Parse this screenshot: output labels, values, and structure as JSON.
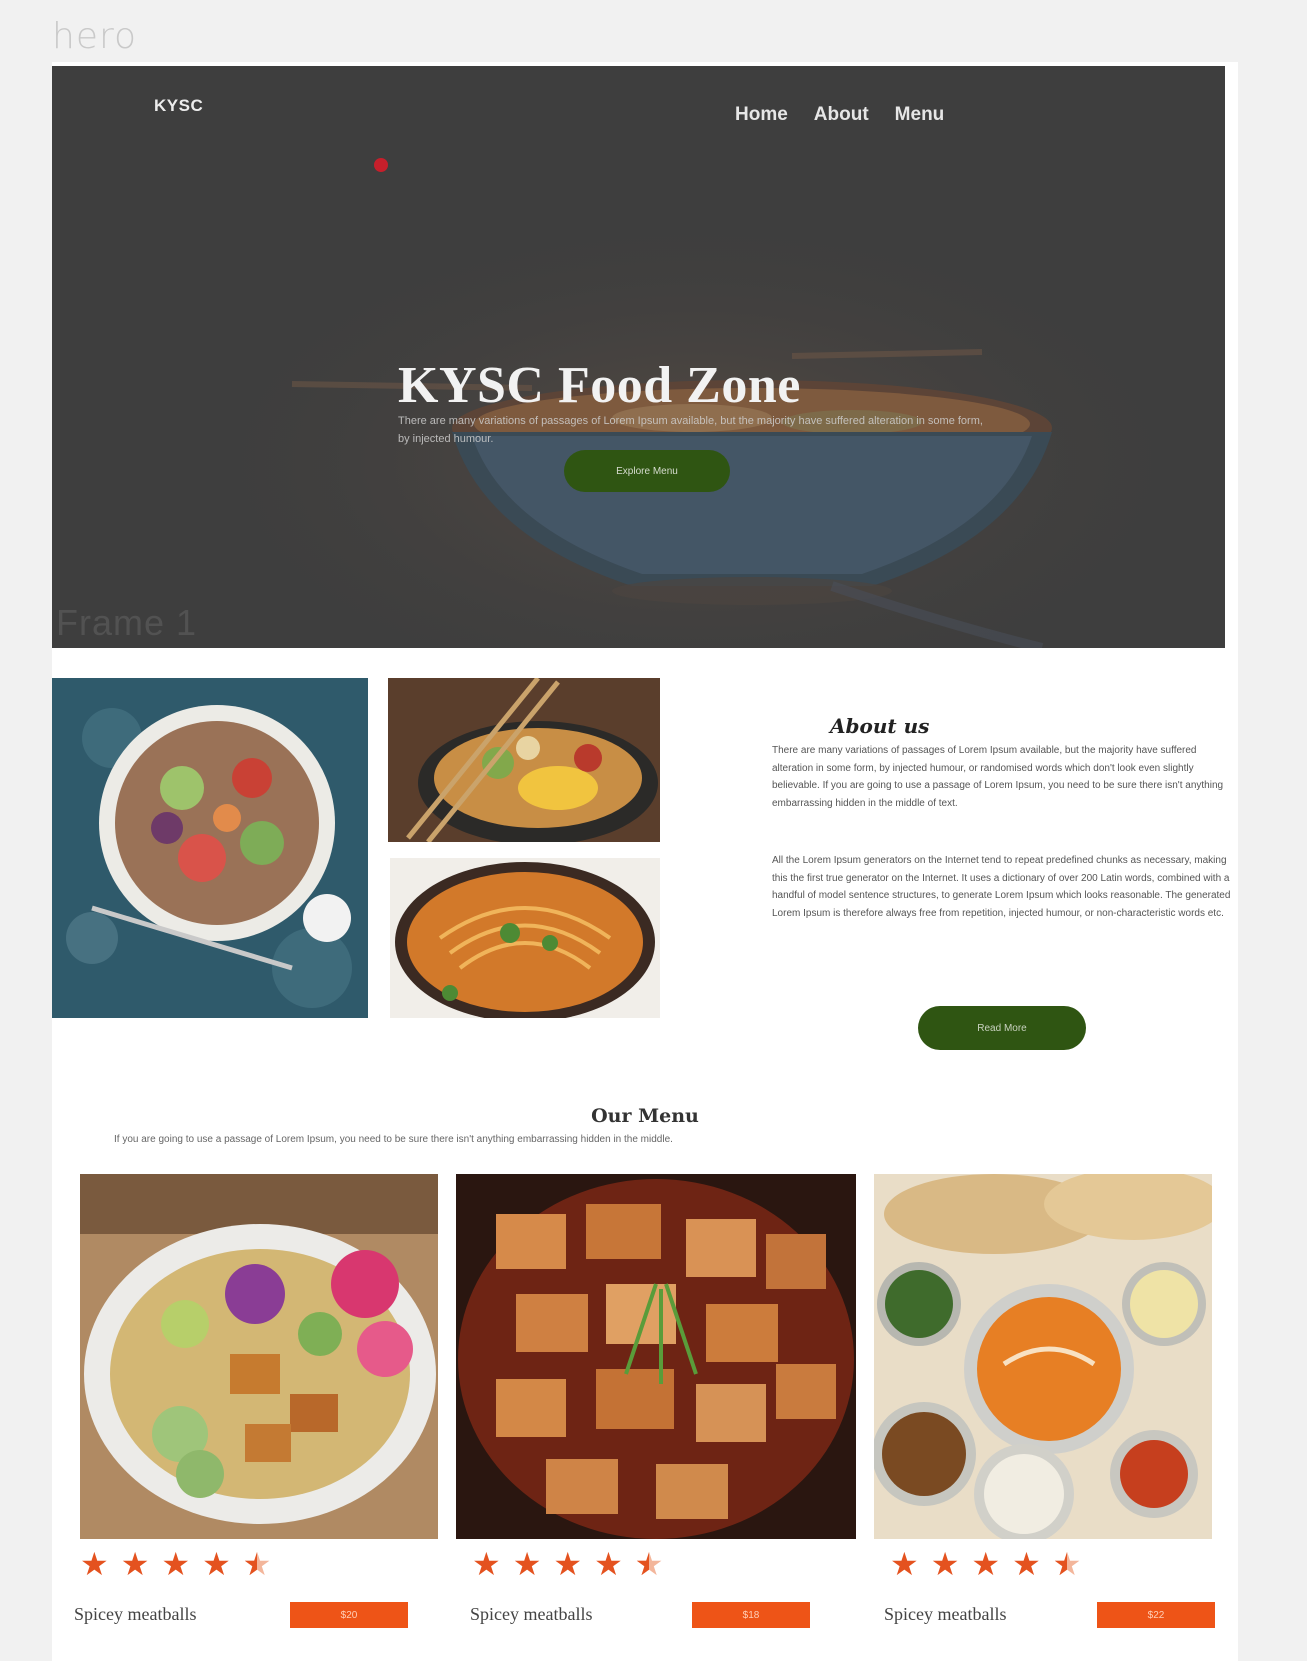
{
  "frame_label": "hero",
  "hero": {
    "logo": "KYSC",
    "nav": [
      "Home",
      "About",
      "Menu"
    ],
    "title": "KYSC Food Zone",
    "subtitle": "There are many variations of passages of Lorem Ipsum available, but the majority have suffered alteration in some form, by injected humour.",
    "cta_label": "Explore Menu",
    "watermark": "Frame 1"
  },
  "about": {
    "title": "About us",
    "paragraph_1": "There are many variations of passages of Lorem Ipsum available, but the majority have suffered alteration in some form, by injected humour, or randomised words which don't look even slightly believable. If you are going to use a passage of Lorem Ipsum, you need to be sure there isn't anything embarrassing hidden in the middle of text.",
    "paragraph_2": "All the Lorem Ipsum generators on the Internet tend to repeat predefined chunks as necessary, making this the first true generator on the Internet. It uses a dictionary of over 200 Latin words, combined with a handful of model sentence structures, to generate Lorem Ipsum which looks reasonable. The generated Lorem Ipsum is therefore always free from repetition, injected humour, or non-characteristic words etc.",
    "button_label": "Read More"
  },
  "menu": {
    "title": "Our Menu",
    "subtitle": "If you are going to use a passage of Lorem Ipsum, you need to be sure there isn't anything embarrassing hidden in the middle.",
    "cards": [
      {
        "name": "Spicey meatballs",
        "price": "$20",
        "rating": 4.5
      },
      {
        "name": "Spicey meatballs",
        "price": "$18",
        "rating": 4.5
      },
      {
        "name": "Spicey meatballs",
        "price": "$22",
        "rating": 4.5
      }
    ]
  },
  "colors": {
    "accent_green": "#2f5512",
    "accent_orange": "#ee5417",
    "hero_overlay": "#3f3f3f"
  }
}
